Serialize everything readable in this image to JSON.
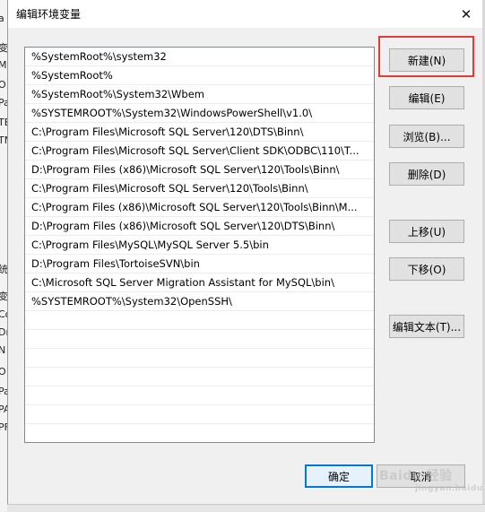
{
  "window": {
    "title": "编辑环境变量",
    "close_glyph": "✕"
  },
  "background_peek": [
    "a",
    "变",
    "M",
    "O",
    "Pa",
    "TE",
    "TM",
    "统",
    "变",
    "Co",
    "Dr",
    "N",
    "O",
    "Pa",
    "PA",
    "PF"
  ],
  "path_list": {
    "items": [
      "%SystemRoot%\\system32",
      "%SystemRoot%",
      "%SystemRoot%\\System32\\Wbem",
      "%SYSTEMROOT%\\System32\\WindowsPowerShell\\v1.0\\",
      "C:\\Program Files\\Microsoft SQL Server\\120\\DTS\\Binn\\",
      "C:\\Program Files\\Microsoft SQL Server\\Client SDK\\ODBC\\110\\T...",
      "D:\\Program Files (x86)\\Microsoft SQL Server\\120\\Tools\\Binn\\",
      "C:\\Program Files\\Microsoft SQL Server\\120\\Tools\\Binn\\",
      "C:\\Program Files (x86)\\Microsoft SQL Server\\120\\Tools\\Binn\\M...",
      "D:\\Program Files (x86)\\Microsoft SQL Server\\120\\DTS\\Binn\\",
      "C:\\Program Files\\MySQL\\MySQL Server 5.5\\bin",
      "D:\\Program Files\\TortoiseSVN\\bin",
      "C:\\Microsoft SQL Server Migration Assistant for MySQL\\bin\\",
      "%SYSTEMROOT%\\System32\\OpenSSH\\",
      "",
      "",
      "",
      "",
      "",
      "",
      ""
    ]
  },
  "buttons": {
    "new": "新建(N)",
    "edit": "编辑(E)",
    "browse": "浏览(B)...",
    "delete": "删除(D)",
    "move_up": "上移(U)",
    "move_down": "下移(O)",
    "edit_text": "编辑文本(T)...",
    "ok": "确定",
    "cancel": "取消"
  },
  "watermark": {
    "word": "Baidu 经验",
    "sub": "jingyan.baidu.com"
  },
  "colors": {
    "highlight": "#e53935",
    "ok_border": "#0078d7"
  }
}
